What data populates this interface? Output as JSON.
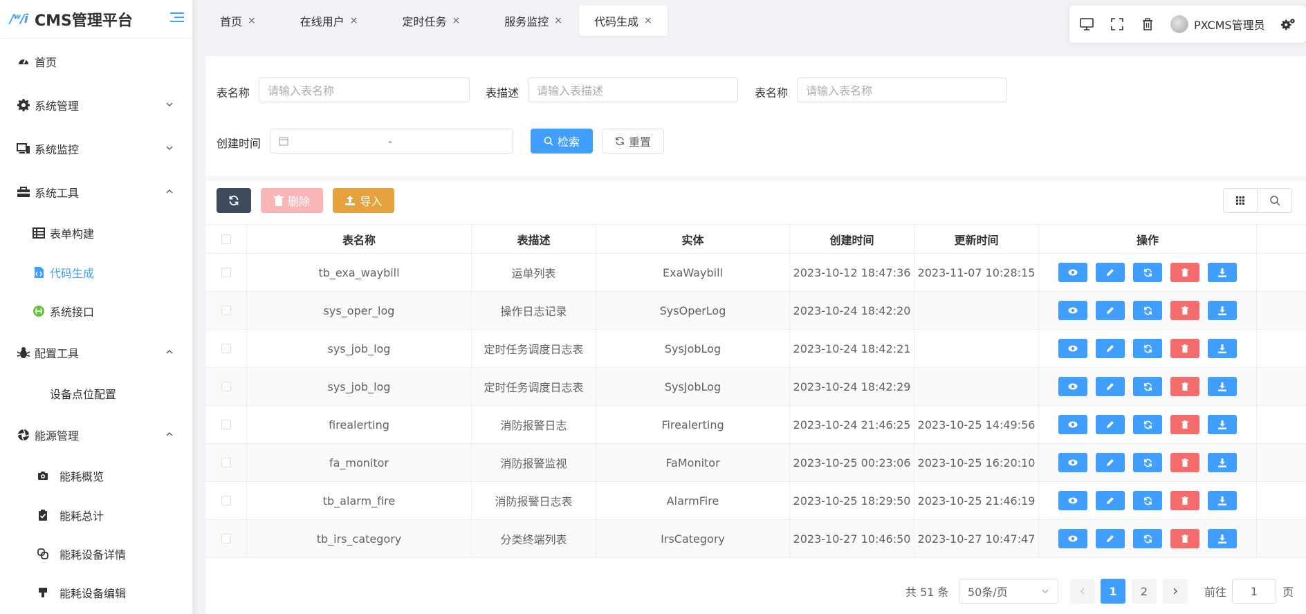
{
  "app": {
    "logo_mark": "/ʷ/i",
    "title": "CMS管理平台"
  },
  "sidebar": {
    "items": [
      {
        "label": "首页",
        "icon": "dashboard-icon"
      },
      {
        "label": "系统管理",
        "icon": "gear-icon"
      },
      {
        "label": "系统监控",
        "icon": "monitor-icon"
      },
      {
        "label": "系统工具",
        "icon": "toolbox-icon"
      },
      {
        "label": "表单构建",
        "icon": "table-icon"
      },
      {
        "label": "代码生成",
        "icon": "code-file-icon"
      },
      {
        "label": "系统接口",
        "icon": "api-icon"
      },
      {
        "label": "配置工具",
        "icon": "bug-icon"
      },
      {
        "label": "设备点位配置",
        "icon": ""
      },
      {
        "label": "能源管理",
        "icon": "aperture-icon"
      },
      {
        "label": "能耗概览",
        "icon": "camera-icon"
      },
      {
        "label": "能耗总计",
        "icon": "clipboard-icon"
      },
      {
        "label": "能耗设备详情",
        "icon": "link-icon"
      },
      {
        "label": "能耗设备编辑",
        "icon": "brush-icon"
      }
    ]
  },
  "tabs": [
    {
      "label": "首页",
      "close": "×"
    },
    {
      "label": "在线用户",
      "close": "×"
    },
    {
      "label": "定时任务",
      "close": "×"
    },
    {
      "label": "服务监控",
      "close": "×"
    },
    {
      "label": "代码生成",
      "close": "×"
    }
  ],
  "user": {
    "name": "PXCMS管理员"
  },
  "search": {
    "table_name_label": "表名称",
    "table_name_placeholder": "请输入表名称",
    "table_desc_label": "表描述",
    "table_desc_placeholder": "请输入表描述",
    "table_name2_label": "表名称",
    "table_name2_placeholder": "请输入表名称",
    "created_label": "创建时间",
    "date_sep": "-",
    "search_btn": "检索",
    "reset_btn": "重置"
  },
  "toolbar": {
    "delete_btn": "删除",
    "import_btn": "导入"
  },
  "table": {
    "headers": [
      "表名称",
      "表描述",
      "实体",
      "创建时间",
      "更新时间",
      "操作"
    ],
    "rows": [
      [
        "tb_exa_waybill",
        "运单列表",
        "ExaWaybill",
        "2023-10-12 18:47:36",
        "2023-11-07 10:28:15"
      ],
      [
        "sys_oper_log",
        "操作日志记录",
        "SysOperLog",
        "2023-10-24 18:42:20",
        ""
      ],
      [
        "sys_job_log",
        "定时任务调度日志表",
        "SysJobLog",
        "2023-10-24 18:42:21",
        ""
      ],
      [
        "sys_job_log",
        "定时任务调度日志表",
        "SysJobLog",
        "2023-10-24 18:42:29",
        ""
      ],
      [
        "firealerting",
        "消防报警日志",
        "Firealerting",
        "2023-10-24 21:46:25",
        "2023-10-25 14:49:56"
      ],
      [
        "fa_monitor",
        "消防报警监视",
        "FaMonitor",
        "2023-10-25 00:23:06",
        "2023-10-25 16:20:10"
      ],
      [
        "tb_alarm_fire",
        "消防报警日志表",
        "AlarmFire",
        "2023-10-25 18:29:50",
        "2023-10-25 21:46:19"
      ],
      [
        "tb_irs_category",
        "分类终端列表",
        "IrsCategory",
        "2023-10-27 10:46:50",
        "2023-10-27 10:47:47"
      ]
    ]
  },
  "pagination": {
    "total": "共 51 条",
    "page_size": "50条/页",
    "pages": [
      "1",
      "2"
    ],
    "goto_label": "前往",
    "goto_value": "1",
    "page_suffix": "页"
  },
  "colors": {
    "primary": "#409eff",
    "danger": "#f56c6c",
    "warning": "#e6a23c",
    "dark": "#3f4b5c"
  }
}
